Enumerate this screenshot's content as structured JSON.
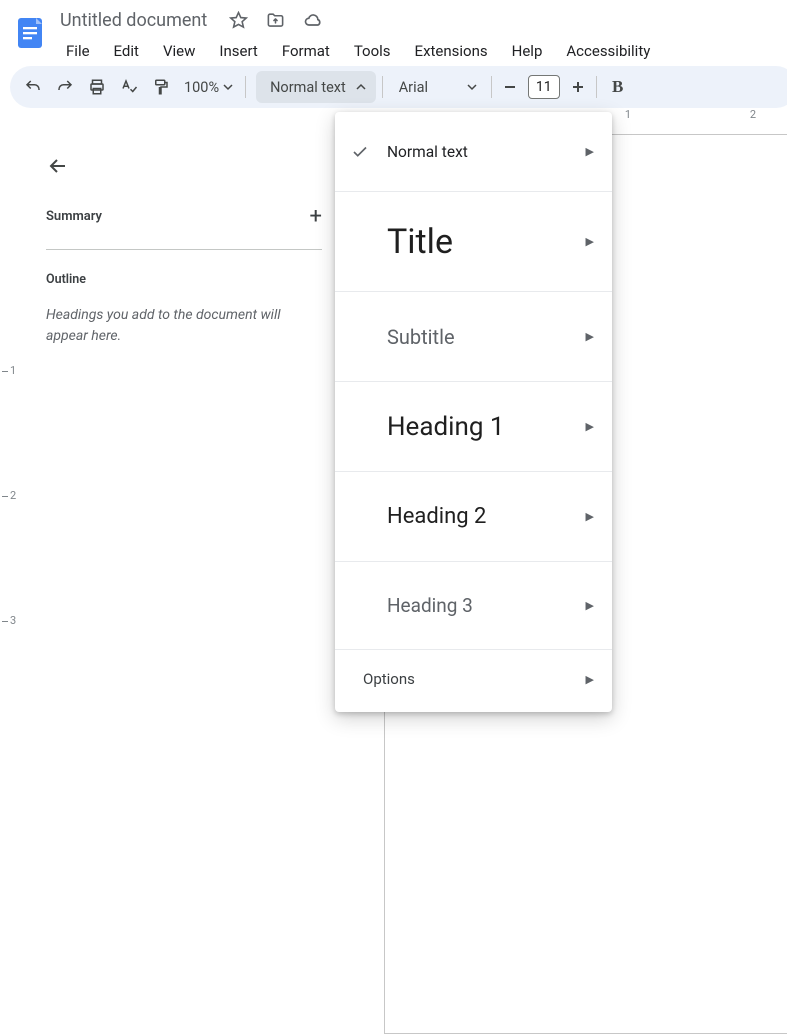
{
  "header": {
    "document_title": "Untitled document",
    "menus": [
      "File",
      "Edit",
      "View",
      "Insert",
      "Format",
      "Tools",
      "Extensions",
      "Help",
      "Accessibility"
    ]
  },
  "toolbar": {
    "zoom_label": "100%",
    "style_selector_label": "Normal text",
    "font_label": "Arial",
    "font_size_value": "11",
    "bold_label": "B"
  },
  "ruler": {
    "h_marks": [
      "1",
      "2"
    ],
    "v_marks": [
      "1",
      "2",
      "3"
    ]
  },
  "outline": {
    "summary_label": "Summary",
    "outline_label": "Outline",
    "empty_text": "Headings you add to the document will appear here."
  },
  "styles_menu": {
    "items": [
      {
        "label": "Normal text",
        "kind": "normal",
        "checked": true
      },
      {
        "label": "Title",
        "kind": "title",
        "checked": false
      },
      {
        "label": "Subtitle",
        "kind": "subtitle",
        "checked": false
      },
      {
        "label": "Heading 1",
        "kind": "h1",
        "checked": false
      },
      {
        "label": "Heading 2",
        "kind": "h2",
        "checked": false
      },
      {
        "label": "Heading 3",
        "kind": "h3",
        "checked": false
      }
    ],
    "options_label": "Options"
  }
}
